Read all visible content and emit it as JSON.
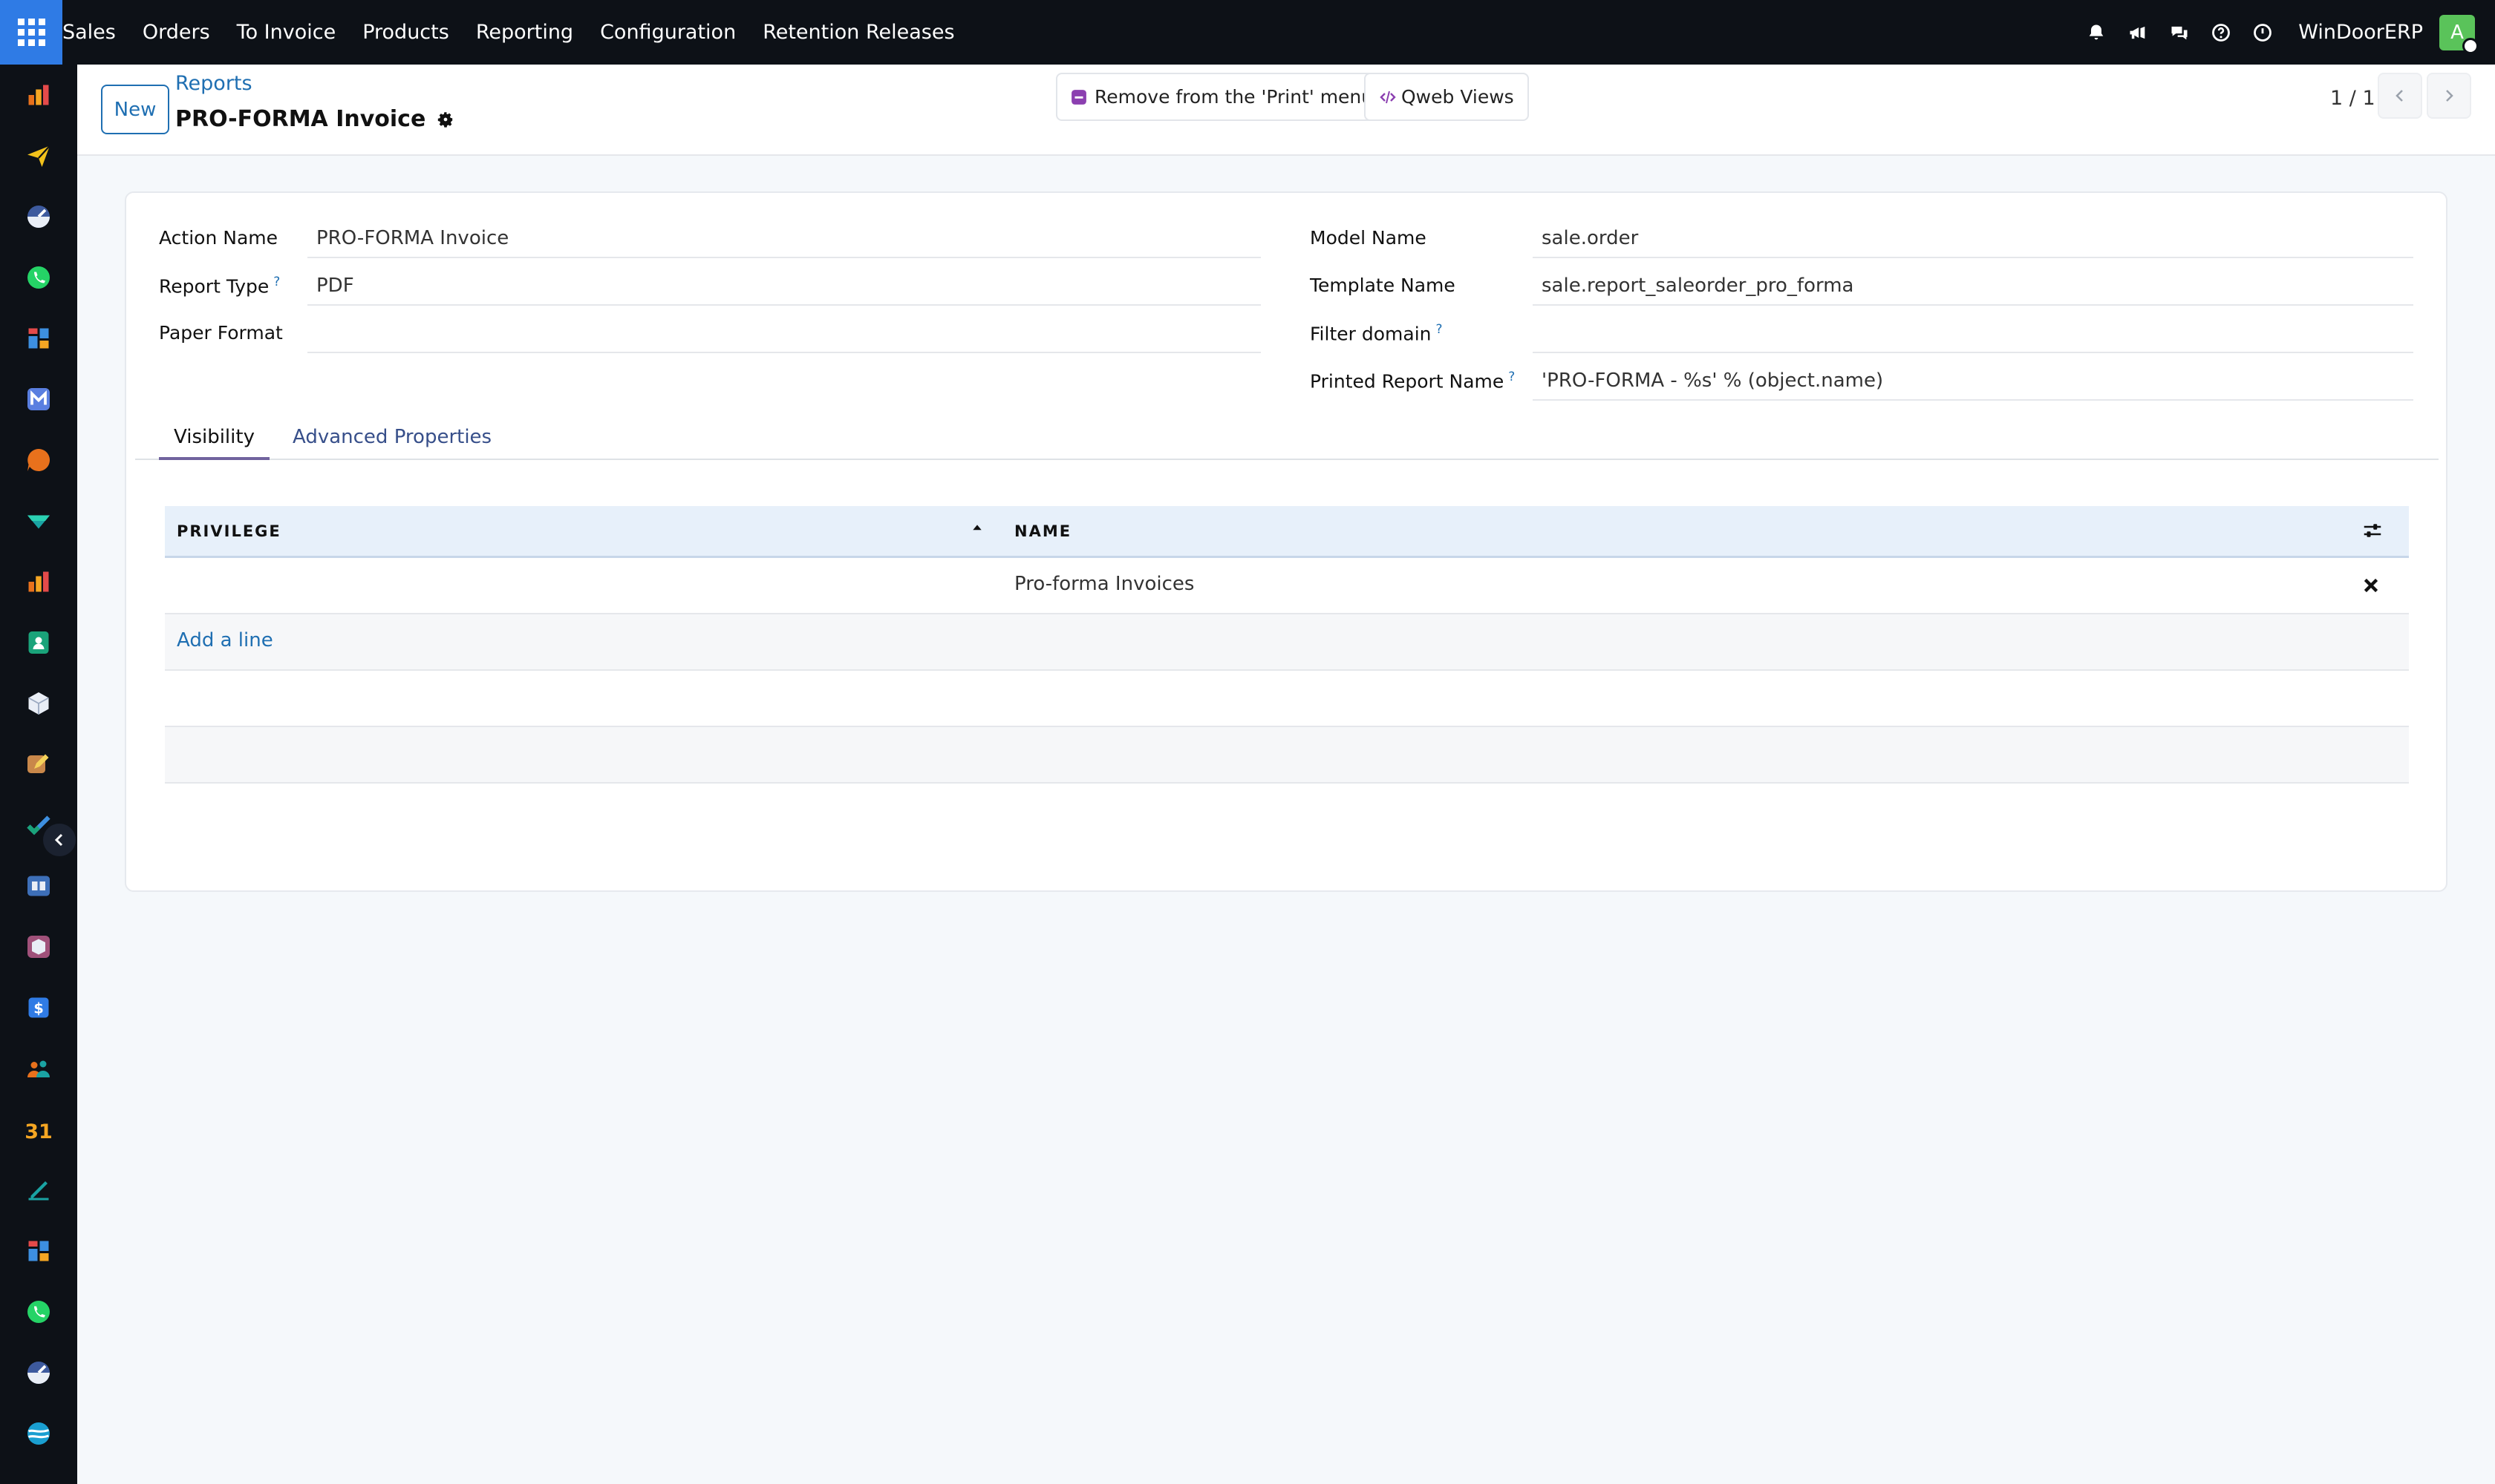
{
  "navbar": {
    "app_name": "Sales",
    "menu": [
      "Orders",
      "To Invoice",
      "Products",
      "Reporting",
      "Configuration",
      "Retention Releases"
    ],
    "company": "WinDoorERP",
    "avatar_letter": "A",
    "icons": [
      "bell-icon",
      "megaphone-icon",
      "chat-icon",
      "help-icon",
      "clock-icon"
    ]
  },
  "sidebar": {
    "icons": [
      "sales-app-icon",
      "send-app-icon",
      "speedometer-app-icon",
      "whatsapp-app-icon",
      "dashboard-app-icon",
      "mail-app-icon",
      "livechat-app-icon",
      "check-app-icon",
      "chart-app-icon",
      "contacts-app-icon",
      "inventory-app-icon",
      "collapse-icon",
      "edit-app-icon",
      "todo-app-icon",
      "knowledge-app-icon",
      "package-app-icon",
      "invoice-app-icon",
      "employees-app-icon",
      "calendar-app-icon",
      "sign-app-icon",
      "dashboard2-app-icon",
      "whatsapp2-app-icon",
      "speedometer2-app-icon",
      "web-app-icon"
    ],
    "calendar_text": "31"
  },
  "control": {
    "new_label": "New",
    "breadcrumb": "Reports",
    "title": "PRO-FORMA Invoice",
    "remove_print_label": "Remove from the 'Print' menu",
    "qweb_label": "Qweb Views",
    "pager": "1 / 1"
  },
  "form": {
    "left": [
      {
        "label": "Action Name",
        "value": "PRO-FORMA Invoice",
        "help": ""
      },
      {
        "label": "Report Type",
        "value": "PDF",
        "help": "?"
      },
      {
        "label": "Paper Format",
        "value": "",
        "help": ""
      }
    ],
    "right": [
      {
        "label": "Model Name",
        "value": "sale.order",
        "help": ""
      },
      {
        "label": "Template Name",
        "value": "sale.report_saleorder_pro_forma",
        "help": ""
      },
      {
        "label": "Filter domain",
        "value": "",
        "help": "?"
      },
      {
        "label": "Printed Report Name",
        "value": "'PRO-FORMA - %s' % (object.name)",
        "help": "?"
      }
    ]
  },
  "tabs": [
    "Visibility",
    "Advanced Properties"
  ],
  "table": {
    "headers": [
      "PRIVILEGE",
      "NAME"
    ],
    "rows": [
      {
        "privilege": "",
        "name": "Pro-forma Invoices"
      }
    ],
    "add_line": "Add a line"
  },
  "colors": {
    "navbar": "#0d1117",
    "apps_button": "#2f7be5",
    "accent_link": "#1f6fb2",
    "avatar": "#5ac35a",
    "tab_active_underline": "#71639e",
    "table_header": "#e7f0fa"
  }
}
